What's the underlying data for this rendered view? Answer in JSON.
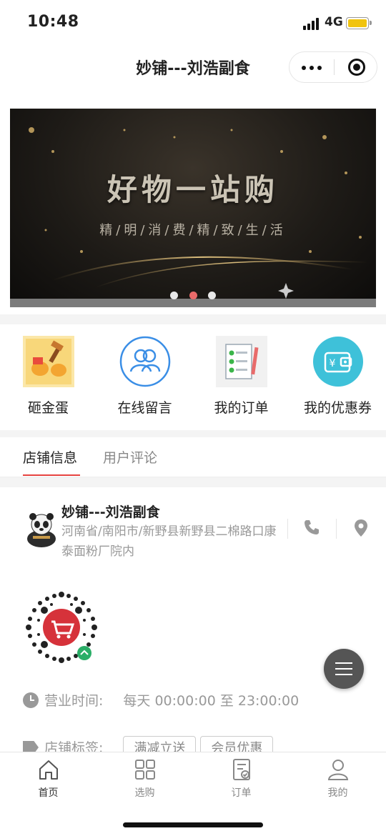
{
  "status_bar": {
    "time": "10:48",
    "network": "4G",
    "battery_color": "#f1c40f"
  },
  "nav": {
    "title": "妙铺---刘浩副食"
  },
  "banner": {
    "title": "好物一站购",
    "subtitle": "精/明/消/费/精/致/生/活",
    "slide_count": 3,
    "active_slide": 2
  },
  "quick_menu": {
    "items": [
      {
        "label": "砸金蛋",
        "icon": "golden-egg-icon"
      },
      {
        "label": "在线留言",
        "icon": "users-icon"
      },
      {
        "label": "我的订单",
        "icon": "order-list-icon"
      },
      {
        "label": "我的优惠券",
        "icon": "wallet-coupon-icon"
      }
    ]
  },
  "tabs": {
    "items": [
      {
        "label": "店铺信息",
        "active": true
      },
      {
        "label": "用户评论",
        "active": false
      }
    ],
    "accent": "#e64340"
  },
  "store": {
    "name": "妙铺---刘浩副食",
    "address": "河南省/南阳市/新野县新野县二棉路口康泰面粉厂院内",
    "hours_label": "营业时间:",
    "hours_value": "每天 00:00:00 至 23:00:00",
    "tags_label": "店铺标签:",
    "tags": [
      "满减立送",
      "会员优惠"
    ]
  },
  "tab_bar": {
    "items": [
      {
        "label": "首页",
        "icon": "home-icon",
        "active": true
      },
      {
        "label": "选购",
        "icon": "grid-icon",
        "active": false
      },
      {
        "label": "订单",
        "icon": "order-icon",
        "active": false
      },
      {
        "label": "我的",
        "icon": "profile-icon",
        "active": false
      }
    ]
  }
}
